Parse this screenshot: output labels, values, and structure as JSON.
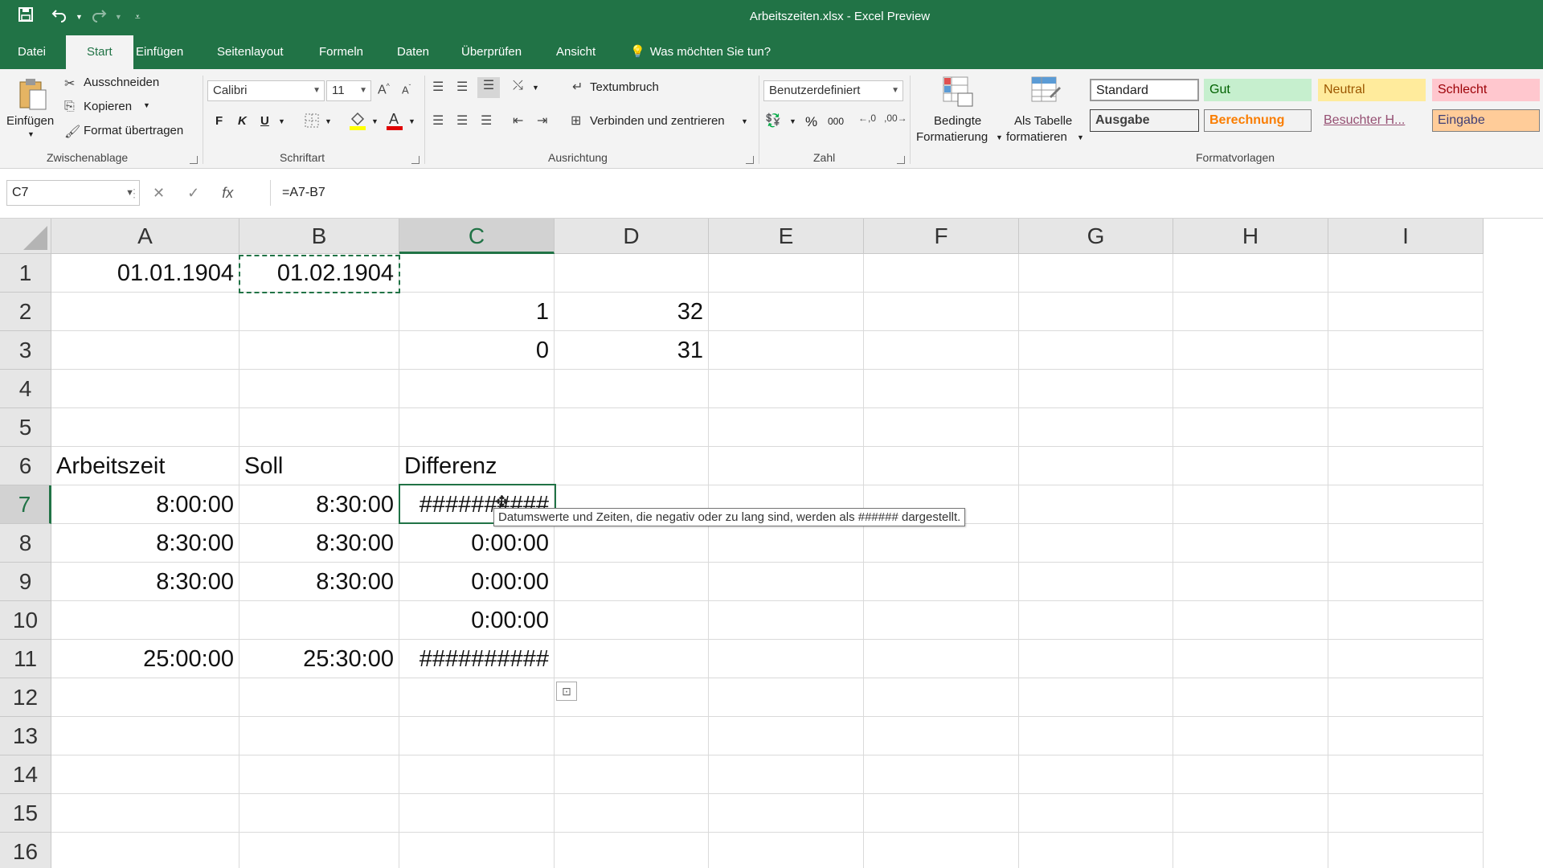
{
  "window": {
    "title": "Arbeitszeiten.xlsx  -  Excel Preview"
  },
  "colors": {
    "brand": "#217346",
    "ribbon_bg": "#f3f3f3"
  },
  "quick_access": {
    "save_icon": "save-icon",
    "undo_icon": "undo-icon",
    "redo_icon": "redo-icon",
    "customize_icon": "customize-icon"
  },
  "tabs": [
    {
      "label": "Datei"
    },
    {
      "label": "Start"
    },
    {
      "label": "Einfügen"
    },
    {
      "label": "Seitenlayout"
    },
    {
      "label": "Formeln"
    },
    {
      "label": "Daten"
    },
    {
      "label": "Überprüfen"
    },
    {
      "label": "Ansicht"
    }
  ],
  "tell_me": "Was möchten Sie tun?",
  "clipboard": {
    "paste": "Einfügen",
    "cut": "Ausschneiden",
    "copy": "Kopieren",
    "format_painter": "Format übertragen",
    "group": "Zwischenablage"
  },
  "font": {
    "name": "Calibri",
    "size": "11",
    "bold": "F",
    "italic": "K",
    "underline": "U",
    "group": "Schriftart"
  },
  "alignment": {
    "wrap": "Textumbruch",
    "merge": "Verbinden und zentrieren",
    "group": "Ausrichtung"
  },
  "number": {
    "format": "Benutzerdefiniert",
    "percent": "%",
    "thousands": "000",
    "group": "Zahl"
  },
  "styles": {
    "conditional": [
      "Bedingte",
      "Formatierung"
    ],
    "table": [
      "Als Tabelle",
      "formatieren"
    ],
    "cells": [
      {
        "label": "Standard"
      },
      {
        "label": "Gut"
      },
      {
        "label": "Neutral"
      },
      {
        "label": "Schlecht"
      },
      {
        "label": "Ausgabe"
      },
      {
        "label": "Berechnung"
      },
      {
        "label": "Besuchter H..."
      },
      {
        "label": "Eingabe"
      }
    ],
    "group": "Formatvorlagen"
  },
  "formula_bar": {
    "name_box": "C7",
    "formula": "=A7-B7"
  },
  "columns": [
    "A",
    "B",
    "C",
    "D",
    "E",
    "F",
    "G",
    "H",
    "I"
  ],
  "rows": [
    "1",
    "2",
    "3",
    "4",
    "5",
    "6",
    "7",
    "8",
    "9",
    "10",
    "11",
    "12",
    "13",
    "14",
    "15",
    "16"
  ],
  "cells": {
    "A1": "01.01.1904",
    "B1": "01.02.1904",
    "C2": "1",
    "D2": "32",
    "C3": "0",
    "D3": "31",
    "A6": "Arbeitszeit",
    "B6": "Soll",
    "C6": "Differenz",
    "A7": "8:00:00",
    "B7": "8:30:00",
    "C7": "##########",
    "A8": "8:30:00",
    "B8": "8:30:00",
    "C8": "0:00:00",
    "A9": "8:30:00",
    "B9": "8:30:00",
    "C9": "0:00:00",
    "C10": "0:00:00",
    "A11": "25:00:00",
    "B11": "25:30:00",
    "C11": "##########"
  },
  "tooltip": "Datumswerte und Zeiten, die negativ oder zu lang sind, werden als ###### dargestellt."
}
